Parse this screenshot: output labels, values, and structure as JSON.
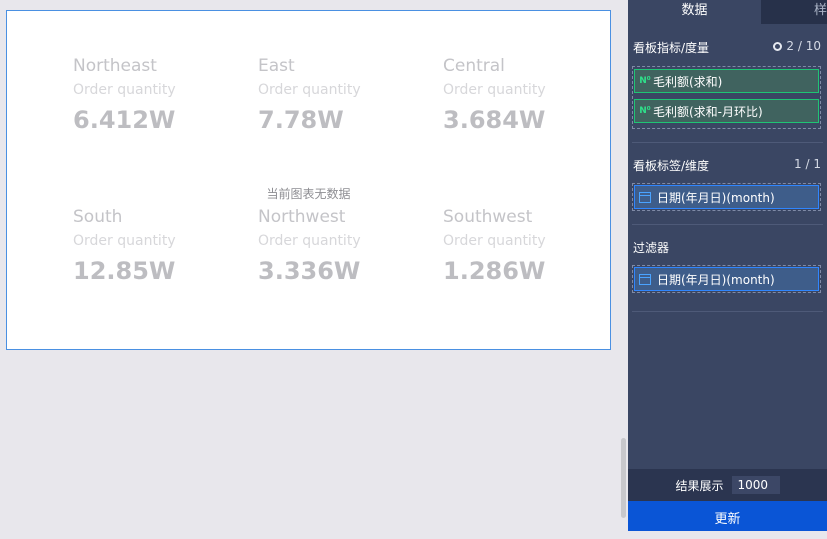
{
  "canvas": {
    "empty_message": "当前图表无数据",
    "kpis": [
      {
        "region": "Northeast",
        "metric": "Order quantity",
        "value": "6.412W"
      },
      {
        "region": "East",
        "metric": "Order quantity",
        "value": "7.78W"
      },
      {
        "region": "Central",
        "metric": "Order quantity",
        "value": "3.684W"
      },
      {
        "region": "South",
        "metric": "Order quantity",
        "value": "12.85W"
      },
      {
        "region": "Northwest",
        "metric": "Order quantity",
        "value": "3.336W"
      },
      {
        "region": "Southwest",
        "metric": "Order quantity",
        "value": "1.286W"
      }
    ]
  },
  "panel": {
    "tabs": [
      {
        "label": "数据",
        "active": true
      },
      {
        "label": "样",
        "active": false
      }
    ],
    "measures": {
      "title": "看板指标/度量",
      "count": "2 / 10",
      "items": [
        {
          "icon": "N⁰",
          "label": "毛利额(求和)"
        },
        {
          "icon": "N⁰",
          "label": "毛利额(求和-月环比)"
        }
      ]
    },
    "dimensions": {
      "title": "看板标签/维度",
      "count": "1 / 1",
      "items": [
        {
          "icon": "calendar-icon",
          "label": "日期(年月日)(month)"
        }
      ]
    },
    "filters": {
      "title": "过滤器",
      "items": [
        {
          "icon": "calendar-icon",
          "label": "日期(年月日)(month)"
        }
      ]
    },
    "footer": {
      "result_label": "结果展示",
      "result_value": "1000",
      "update_label": "更新"
    }
  }
}
